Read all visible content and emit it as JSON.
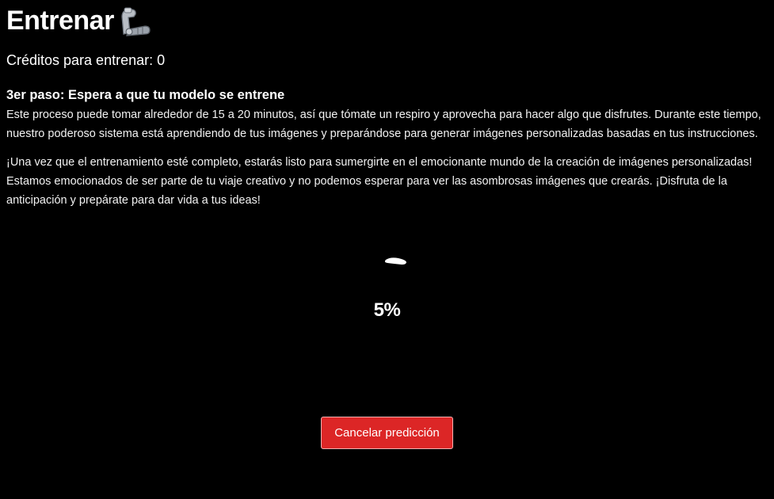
{
  "header": {
    "title": "Entrenar",
    "title_icon": "flexed-biceps-mechanical-arm-icon"
  },
  "credits": {
    "label": "Créditos para entrenar: 0"
  },
  "step": {
    "title": "3er paso: Espera a que tu modelo se entrene",
    "paragraph_1": "Este proceso puede tomar alrededor de 15 a 20 minutos, así que tómate un respiro y aprovecha para hacer algo que disfrutes. Durante este tiempo, nuestro poderoso sistema está aprendiendo de tus imágenes y preparándose para generar imágenes personalizadas basadas en tus instrucciones.",
    "paragraph_2": "¡Una vez que el entrenamiento esté completo, estarás listo para sumergirte en el emocionante mundo de la creación de imágenes personalizadas! Estamos emocionados de ser parte de tu viaje creativo y no podemos esperar para ver las asombrosas imágenes que crearás. ¡Disfruta de la anticipación y prepárate para dar vida a tus ideas!"
  },
  "progress": {
    "spinner_icon": "loading-spinner-icon",
    "percent_label": "5%",
    "value": 0.05
  },
  "actions": {
    "cancel_label": "Cancelar predicción"
  },
  "colors": {
    "background": "#000000",
    "text": "#ffffff",
    "cancel_button": "#dc2626"
  }
}
